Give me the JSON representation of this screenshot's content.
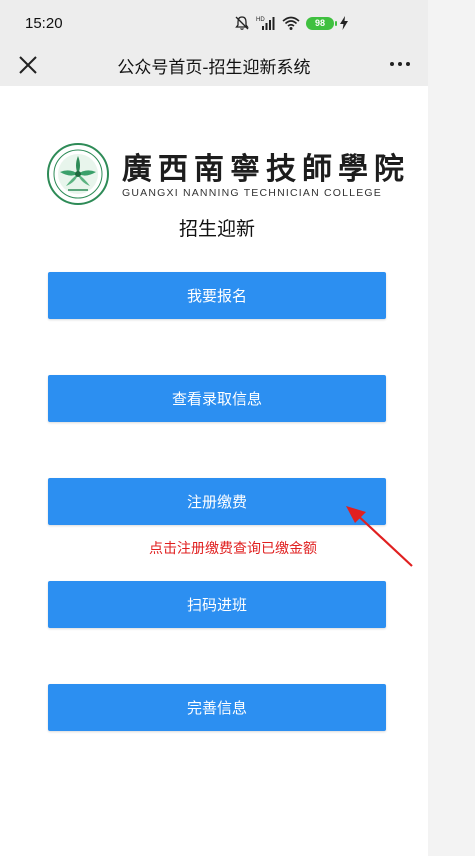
{
  "status_bar": {
    "time": "15:20",
    "battery_level": "98",
    "icons": [
      "mute-icon",
      "signal-hd-icon",
      "wifi-icon",
      "battery-icon",
      "charging-icon"
    ]
  },
  "nav_bar": {
    "title": "公众号首页-招生迎新系统",
    "close_icon": "close-icon",
    "more_icon": "more-icon"
  },
  "logo": {
    "name_cn": "廣西南寧技師學院",
    "name_en": "GUANGXI NANNING TECHNICIAN COLLEGE"
  },
  "page_heading": "招生迎新",
  "menu_buttons": [
    {
      "label": "我要报名"
    },
    {
      "label": "查看录取信息"
    },
    {
      "label": "注册缴费"
    },
    {
      "label": "扫码进班"
    },
    {
      "label": "完善信息"
    }
  ],
  "annotation": {
    "text": "点击注册缴费查询已缴金额",
    "color": "#e02020"
  },
  "colors": {
    "button_bg": "#2c8ff1",
    "nav_bg": "#ededed"
  }
}
